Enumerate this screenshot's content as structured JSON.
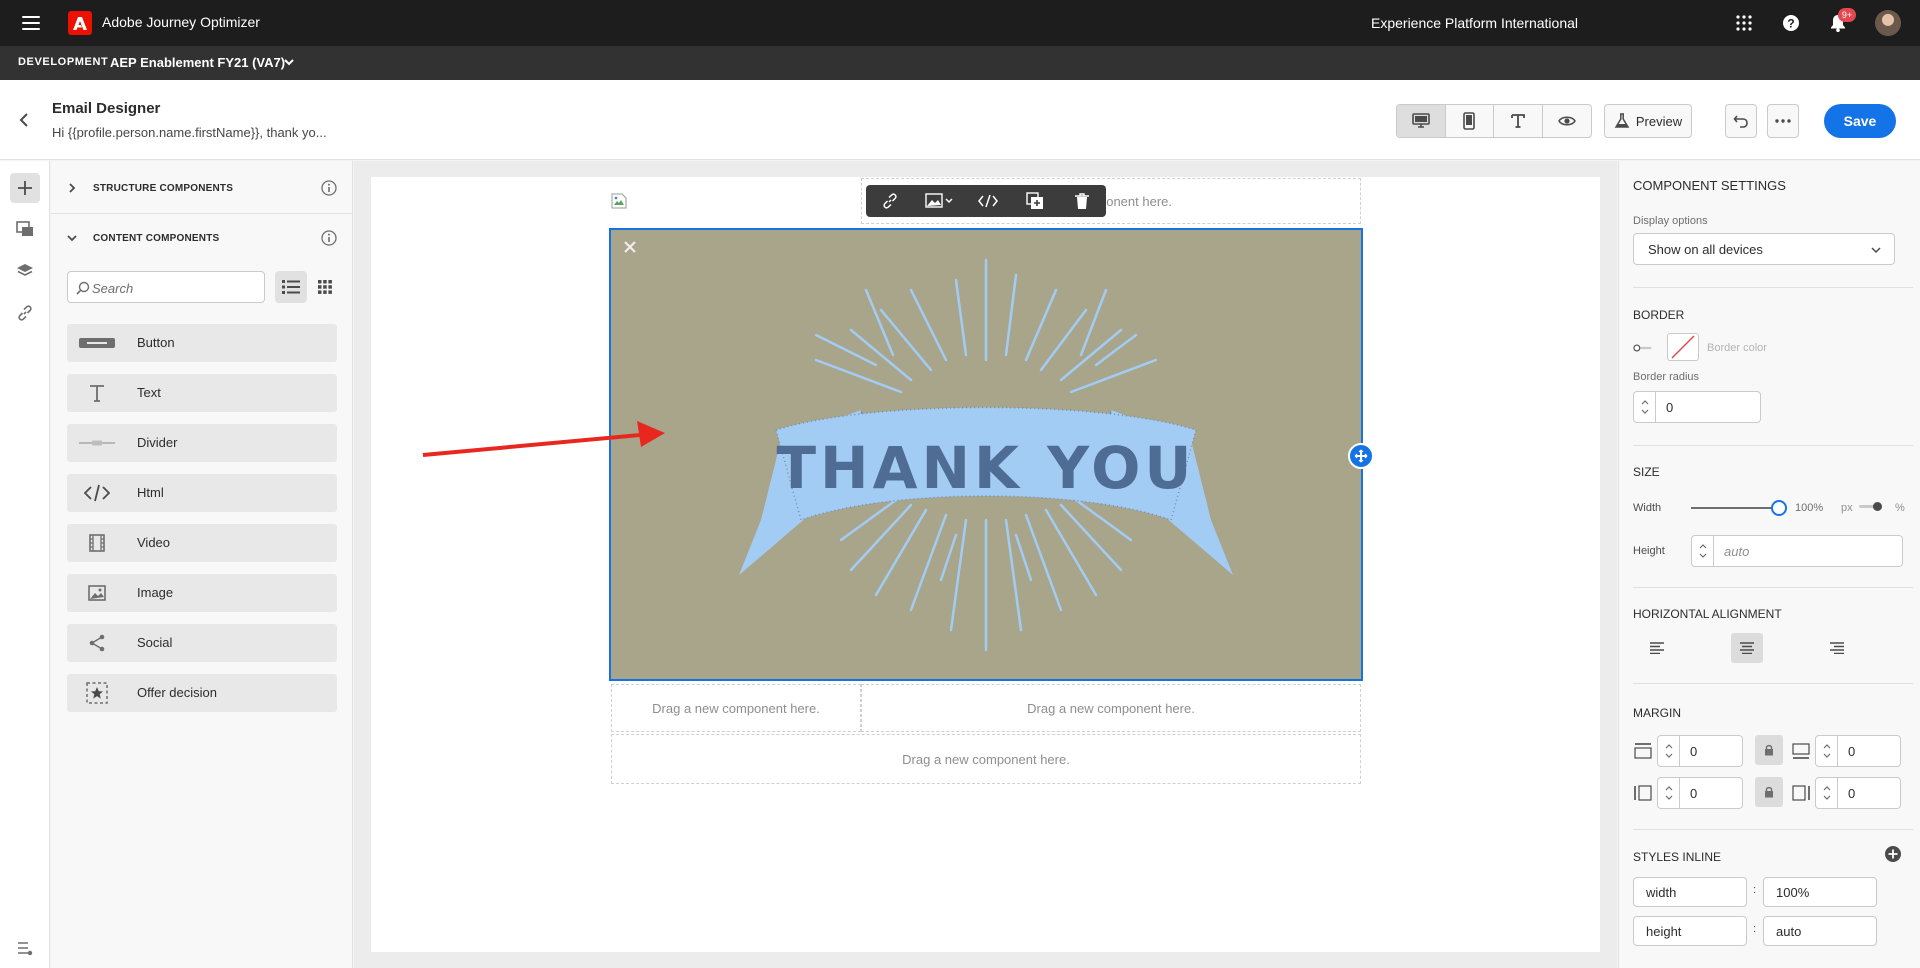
{
  "shell": {
    "app_name": "Adobe Journey Optimizer",
    "org_name": "Experience Platform International",
    "notification_count": "9+"
  },
  "sandbox": {
    "env_label": "DEVELOPMENT",
    "name": "AEP Enablement FY21 (VA7)"
  },
  "header": {
    "title": "Email Designer",
    "subtitle": "Hi {{profile.person.name.firstName}}, thank yo...",
    "preview_label": "Preview",
    "save_label": "Save"
  },
  "components_panel": {
    "structure_label": "STRUCTURE COMPONENTS",
    "content_label": "CONTENT COMPONENTS",
    "search_placeholder": "Search",
    "items": [
      {
        "label": "Button",
        "icon": "button-icon"
      },
      {
        "label": "Text",
        "icon": "text-icon"
      },
      {
        "label": "Divider",
        "icon": "divider-icon"
      },
      {
        "label": "Html",
        "icon": "code-icon"
      },
      {
        "label": "Video",
        "icon": "video-icon"
      },
      {
        "label": "Image",
        "icon": "image-icon"
      },
      {
        "label": "Social",
        "icon": "share-icon"
      },
      {
        "label": "Offer decision",
        "icon": "offer-decision-icon"
      }
    ]
  },
  "canvas": {
    "drop_text": "Drag a new component here.",
    "drop_text_partial": "omponent here.",
    "image_text": "THANK YOU"
  },
  "settings": {
    "title": "COMPONENT SETTINGS",
    "display_options_label": "Display options",
    "display_options_value": "Show on all devices",
    "border_label": "BORDER",
    "border_color_label": "Border color",
    "border_radius_label": "Border radius",
    "border_radius_value": "0",
    "size_label": "SIZE",
    "width_label": "Width",
    "width_value": "100%",
    "width_fraction": 1.0,
    "unit_px": "px",
    "unit_pct": "%",
    "height_label": "Height",
    "height_placeholder": "auto",
    "horizontal_alignment_label": "HORIZONTAL ALIGNMENT",
    "margin_label": "MARGIN",
    "margin_top": "0",
    "margin_bottom": "0",
    "margin_left": "0",
    "margin_right": "0",
    "styles_inline_label": "STYLES INLINE",
    "style_rows": [
      {
        "key": "width",
        "value": "100%"
      },
      {
        "key": "height",
        "value": "auto"
      }
    ],
    "colon": ":"
  },
  "colors": {
    "accent": "#1473e6",
    "shell_bg": "#1d1d1d",
    "image_bg": "#a8a58a",
    "banner": "#a3ccf5",
    "annotation_arrow": "#e8271f"
  }
}
